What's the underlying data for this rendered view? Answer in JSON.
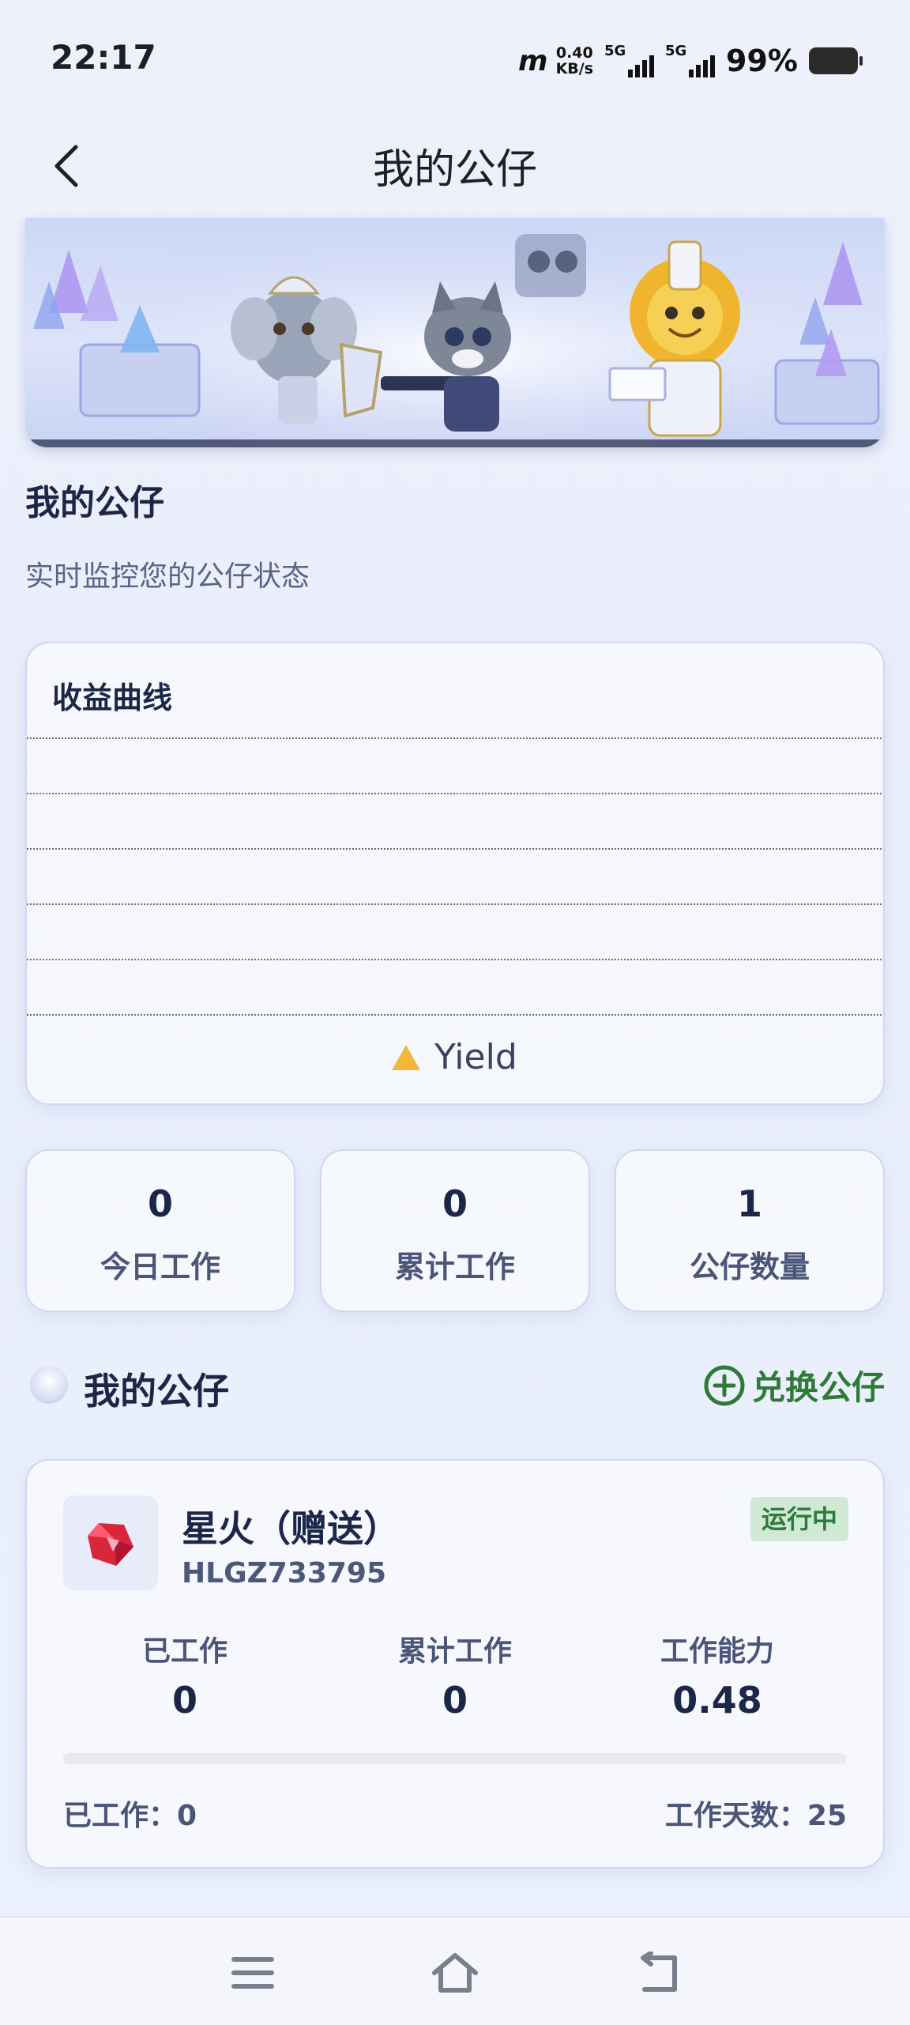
{
  "status_bar": {
    "time": "22:17",
    "carrier_logo": "m",
    "net_speed_value": "0.40",
    "net_speed_unit": "KB/s",
    "signal1_label": "5G",
    "signal2_label": "5G",
    "battery": "99%"
  },
  "header": {
    "title": "我的公仔",
    "back_icon": "chevron-left-icon"
  },
  "section": {
    "title": "我的公仔",
    "subtitle": "实时监控您的公仔状态"
  },
  "chart_data": {
    "type": "line",
    "title": "收益曲线",
    "series": [
      {
        "name": "Yield",
        "color": "#f3b73a",
        "values": []
      }
    ],
    "grid": true,
    "gridlines": 6,
    "legend_position": "bottom-center"
  },
  "stats": [
    {
      "value": "0",
      "label": "今日工作"
    },
    {
      "value": "0",
      "label": "累计工作"
    },
    {
      "value": "1",
      "label": "公仔数量"
    }
  ],
  "mine": {
    "title": "我的公仔",
    "exchange_label": "兑换公仔",
    "exchange_icon": "plus-circle-icon"
  },
  "bot": {
    "name": "星火（赠送）",
    "id": "HLGZ733795",
    "status": "运行中",
    "worked_label": "已工作",
    "worked_value": "0",
    "total_label": "累计工作",
    "total_value": "0",
    "capacity_label": "工作能力",
    "capacity_value": "0.48",
    "progress_fraction": 0,
    "footer_worked": "已工作：0",
    "footer_days": "工作天数：25"
  },
  "colors": {
    "accent_green": "#2f7a36",
    "status_bg": "#cfe9d5",
    "legend_marker": "#f3b73a"
  },
  "nav": {
    "menu_icon": "menu-icon",
    "home_icon": "home-icon",
    "back_icon": "back-icon"
  }
}
